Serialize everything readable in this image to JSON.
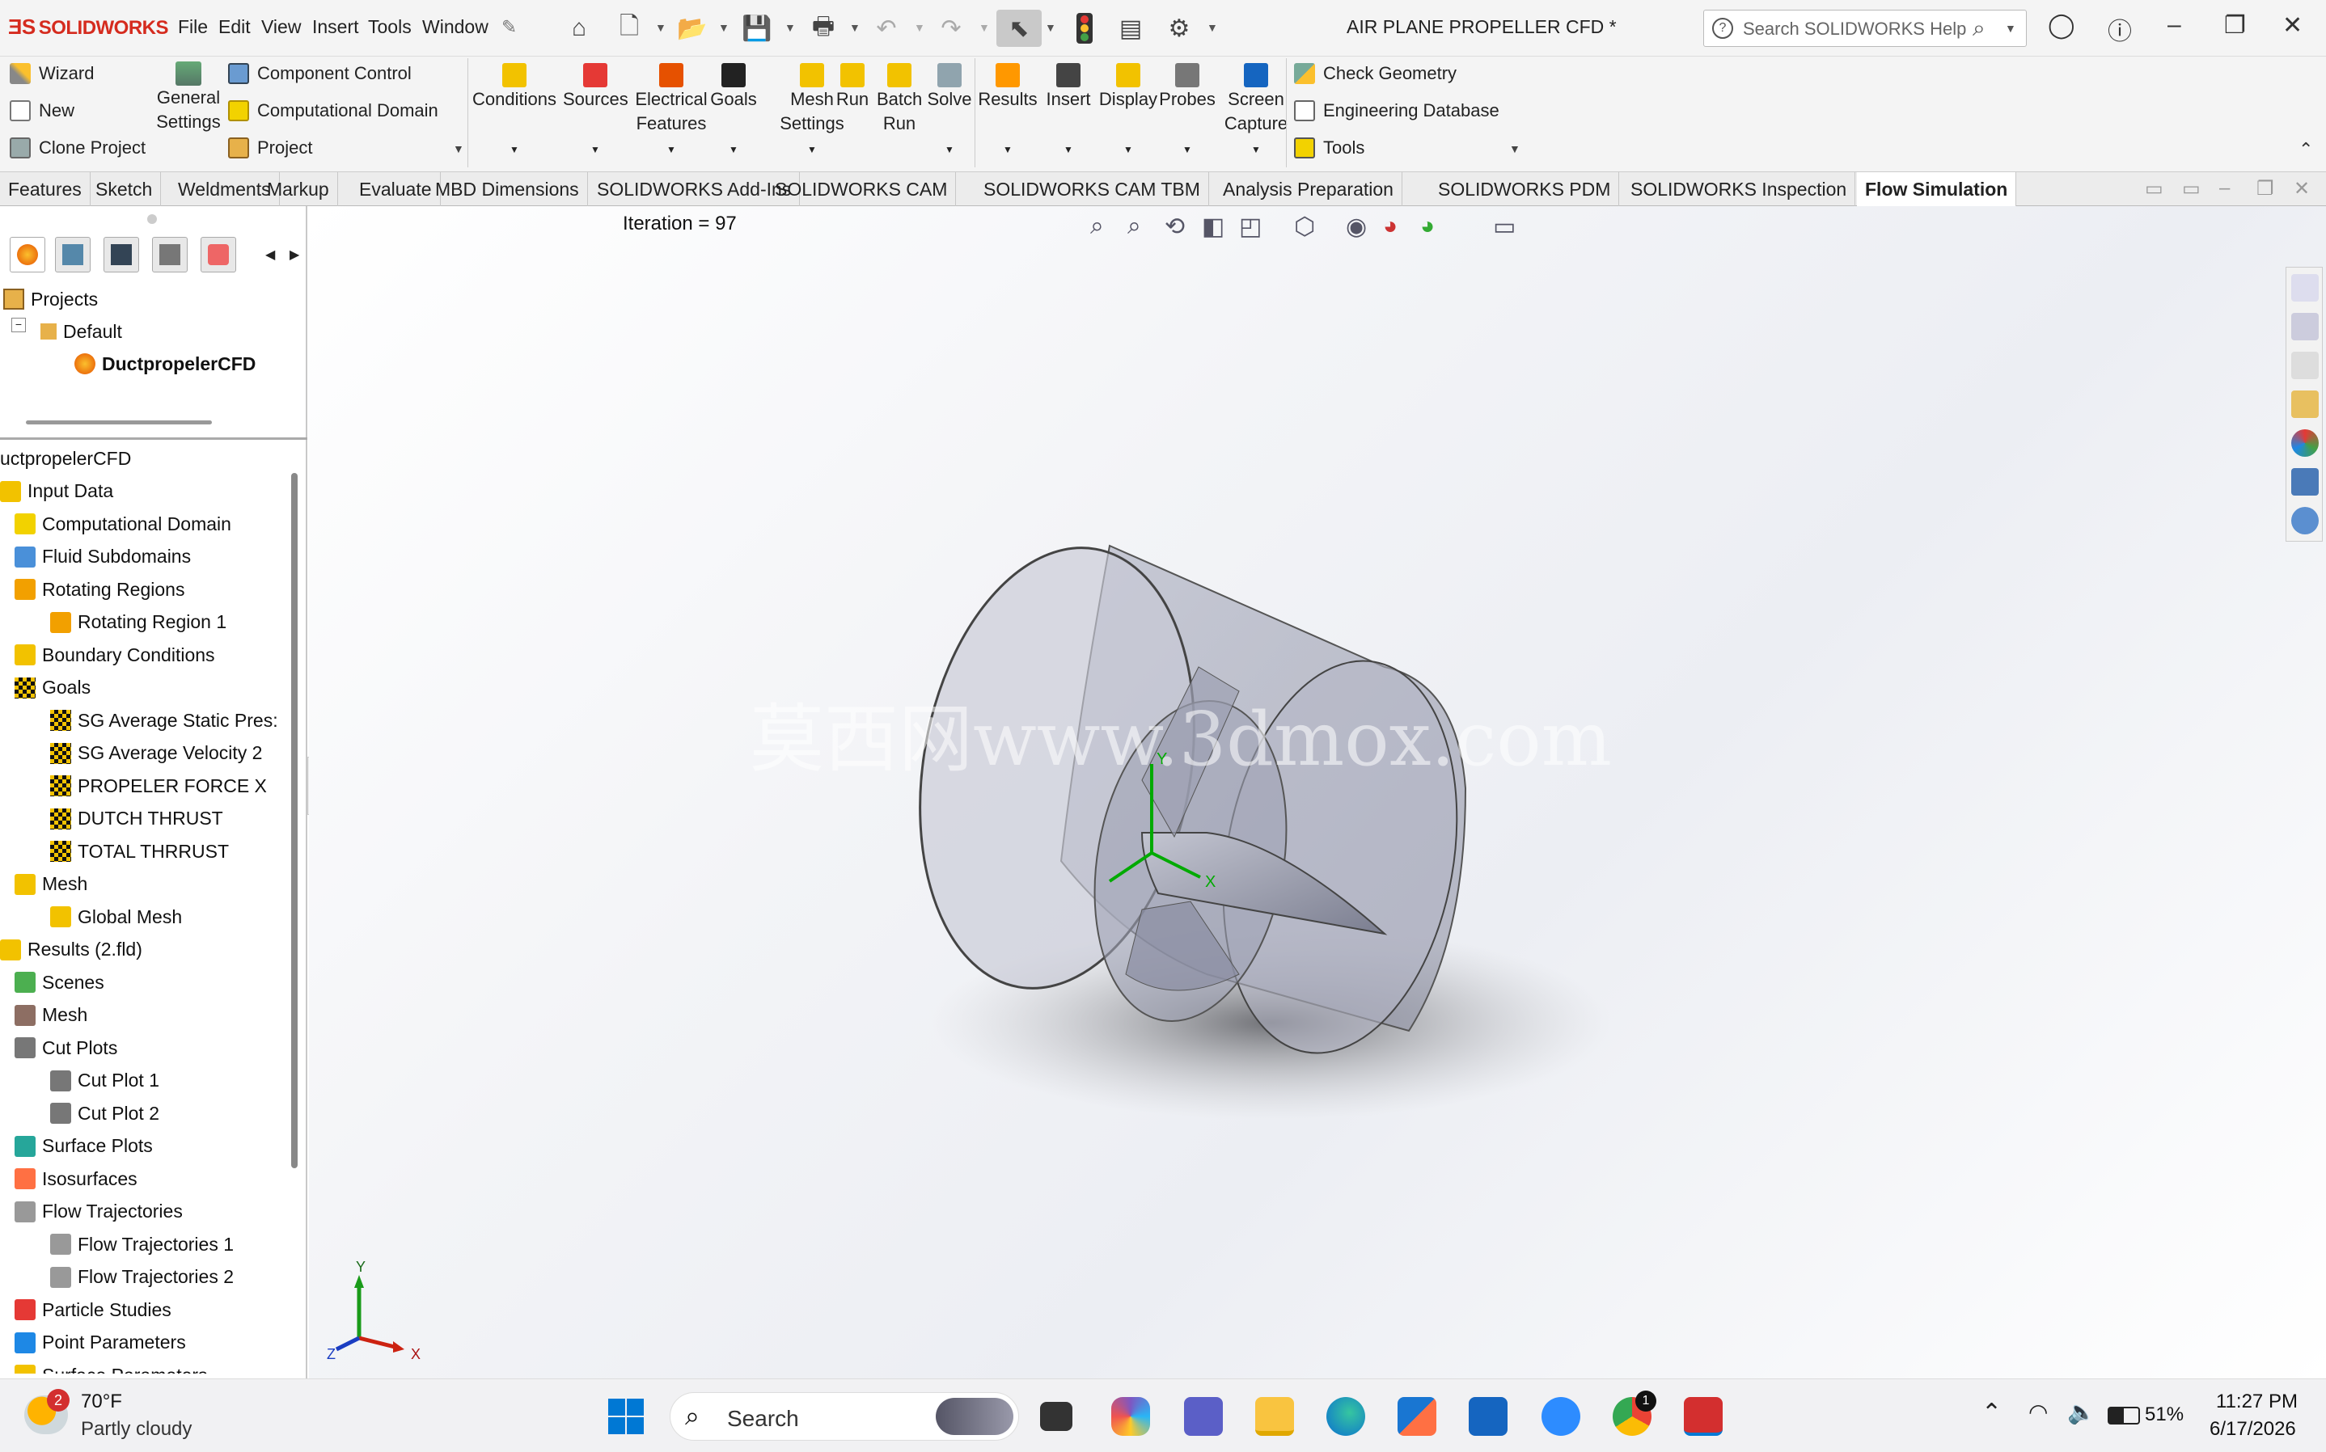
{
  "titlebar": {
    "app_name": "SOLIDWORKS",
    "menus": [
      "File",
      "Edit",
      "View",
      "Insert",
      "Tools",
      "Window"
    ],
    "document_title": "AIR PLANE PROPELLER CFD *",
    "search_placeholder": "Search SOLIDWORKS Help"
  },
  "command_manager": {
    "left_group": [
      "Wizard",
      "New",
      "Clone Project"
    ],
    "general_settings": [
      "General",
      "Settings"
    ],
    "middle_group": [
      "Component Control",
      "Computational Domain",
      "Project"
    ],
    "buttons": [
      {
        "l1": "Conditions",
        "l2": ""
      },
      {
        "l1": "Sources",
        "l2": ""
      },
      {
        "l1": "Electrical",
        "l2": "Features"
      },
      {
        "l1": "Goals",
        "l2": ""
      },
      {
        "l1": "Mesh",
        "l2": "Settings"
      },
      {
        "l1": "Run",
        "l2": ""
      },
      {
        "l1": "Batch",
        "l2": "Run"
      },
      {
        "l1": "Solve",
        "l2": ""
      },
      {
        "l1": "Results",
        "l2": ""
      },
      {
        "l1": "Insert",
        "l2": ""
      },
      {
        "l1": "Display",
        "l2": ""
      },
      {
        "l1": "Probes",
        "l2": ""
      },
      {
        "l1": "Screen",
        "l2": "Capture"
      }
    ],
    "right_group": [
      "Check Geometry",
      "Engineering Database",
      "Tools"
    ]
  },
  "tabs": [
    "Features",
    "Sketch",
    "Weldments",
    "Markup",
    "Evaluate",
    "MBD Dimensions",
    "SOLIDWORKS Add-Ins",
    "SOLIDWORKS CAM",
    "SOLIDWORKS CAM TBM",
    "Analysis Preparation",
    "SOLIDWORKS PDM",
    "SOLIDWORKS Inspection",
    "Flow Simulation"
  ],
  "active_tab": "Flow Simulation",
  "projects_tree": {
    "root": "Projects",
    "config": "Default",
    "project": "DuctpropelerCFD"
  },
  "analysis_tree": [
    {
      "label": "uctpropelerCFD",
      "level": 0,
      "icon": "none"
    },
    {
      "label": "Input Data",
      "level": 0,
      "icon": "folder-icon"
    },
    {
      "label": "Computational Domain",
      "level": 1,
      "icon": "domain-icon"
    },
    {
      "label": "Fluid Subdomains",
      "level": 1,
      "icon": "subdomain-icon"
    },
    {
      "label": "Rotating Regions",
      "level": 1,
      "icon": "rotating-icon"
    },
    {
      "label": "Rotating Region 1",
      "level": 2,
      "icon": "rotating-icon"
    },
    {
      "label": "Boundary Conditions",
      "level": 1,
      "icon": "boundary-icon"
    },
    {
      "label": "Goals",
      "level": 1,
      "icon": "goal-flag-icon"
    },
    {
      "label": "SG Average Static Pres:",
      "level": 2,
      "icon": "goal-flag-icon"
    },
    {
      "label": "SG Average Velocity 2",
      "level": 2,
      "icon": "goal-flag-icon"
    },
    {
      "label": "PROPELER FORCE X",
      "level": 2,
      "icon": "goal-flag-icon"
    },
    {
      "label": "DUTCH THRUST",
      "level": 2,
      "icon": "goal-flag-icon"
    },
    {
      "label": "TOTAL THRRUST",
      "level": 2,
      "icon": "goal-flag-icon"
    },
    {
      "label": "Mesh",
      "level": 1,
      "icon": "mesh-folder-icon"
    },
    {
      "label": "Global Mesh",
      "level": 2,
      "icon": "mesh-folder-icon"
    },
    {
      "label": "Results (2.fld)",
      "level": 0,
      "icon": "results-icon"
    },
    {
      "label": "Scenes",
      "level": 1,
      "icon": "scenes-icon"
    },
    {
      "label": "Mesh",
      "level": 1,
      "icon": "grid-icon"
    },
    {
      "label": "Cut Plots",
      "level": 1,
      "icon": "cut-plot-icon"
    },
    {
      "label": "Cut Plot 1",
      "level": 2,
      "icon": "cut-plot-icon"
    },
    {
      "label": "Cut Plot 2",
      "level": 2,
      "icon": "cut-plot-icon"
    },
    {
      "label": "Surface Plots",
      "level": 1,
      "icon": "surface-plot-icon"
    },
    {
      "label": "Isosurfaces",
      "level": 1,
      "icon": "isosurface-icon"
    },
    {
      "label": "Flow Trajectories",
      "level": 1,
      "icon": "trajectory-icon"
    },
    {
      "label": "Flow Trajectories 1",
      "level": 2,
      "icon": "trajectory-icon"
    },
    {
      "label": "Flow Trajectories 2",
      "level": 2,
      "icon": "trajectory-icon"
    },
    {
      "label": "Particle Studies",
      "level": 1,
      "icon": "particle-icon"
    },
    {
      "label": "Point Parameters",
      "level": 1,
      "icon": "point-param-icon"
    },
    {
      "label": "Surface Parameters",
      "level": 1,
      "icon": "surface-param-icon"
    }
  ],
  "viewport": {
    "iteration_text": "Iteration = 97",
    "watermark": "莫西网www.3dmox.com",
    "triad": {
      "x": "X",
      "y": "Y",
      "z": "Z"
    }
  },
  "taskbar": {
    "weather_temp": "70°F",
    "weather_desc": "Partly cloudy",
    "weather_badge": "2",
    "search_label": "Search",
    "battery": "51%",
    "time": "11:27 PM",
    "date": "6/17/2026",
    "chrome_badge": "1"
  },
  "colors": {
    "brand_red": "#d52b1e",
    "goal_flag": "#111111",
    "folder_yellow": "#f2c200",
    "windows_blue": "#0078d4"
  }
}
